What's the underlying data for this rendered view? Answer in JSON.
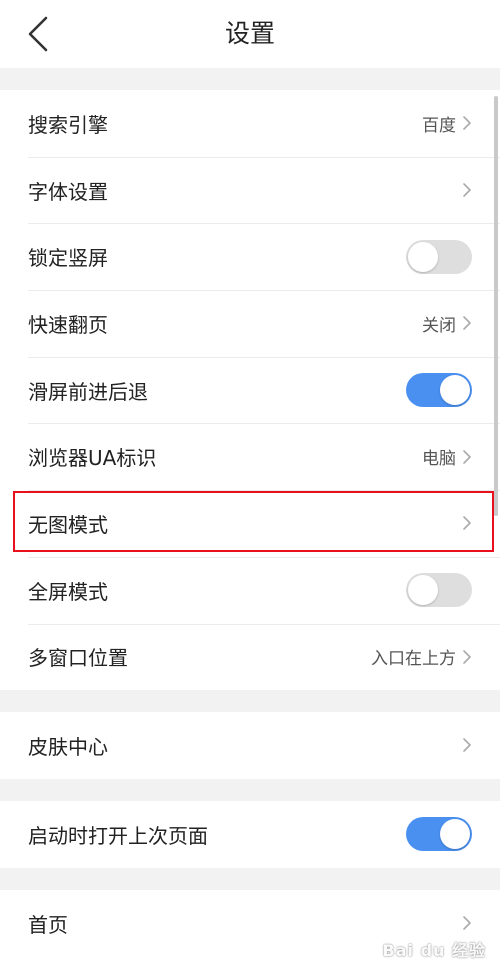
{
  "header": {
    "title": "设置",
    "back_icon": "chevron-left-icon"
  },
  "colors": {
    "toggle_on": "#4a90f0",
    "toggle_off": "#dedede",
    "highlight": "#e8101c"
  },
  "groups": [
    {
      "items": [
        {
          "label": "搜索引擎",
          "value": "百度",
          "control": "chevron"
        },
        {
          "label": "字体设置",
          "value": "",
          "control": "chevron"
        },
        {
          "label": "锁定竖屏",
          "control": "toggle",
          "on": false
        },
        {
          "label": "快速翻页",
          "value": "关闭",
          "control": "chevron"
        },
        {
          "label": "滑屏前进后退",
          "control": "toggle",
          "on": true
        },
        {
          "label": "浏览器UA标识",
          "value": "电脑",
          "control": "chevron"
        },
        {
          "label": "无图模式",
          "value": "",
          "control": "chevron",
          "highlighted": true
        },
        {
          "label": "全屏模式",
          "control": "toggle",
          "on": false
        },
        {
          "label": "多窗口位置",
          "value": "入口在上方",
          "control": "chevron"
        }
      ]
    },
    {
      "items": [
        {
          "label": "皮肤中心",
          "value": "",
          "control": "chevron"
        }
      ]
    },
    {
      "items": [
        {
          "label": "启动时打开上次页面",
          "control": "toggle",
          "on": true
        }
      ]
    },
    {
      "items": [
        {
          "label": "首页",
          "value": "",
          "control": "chevron"
        }
      ]
    }
  ],
  "watermark": "Bai du 经验"
}
